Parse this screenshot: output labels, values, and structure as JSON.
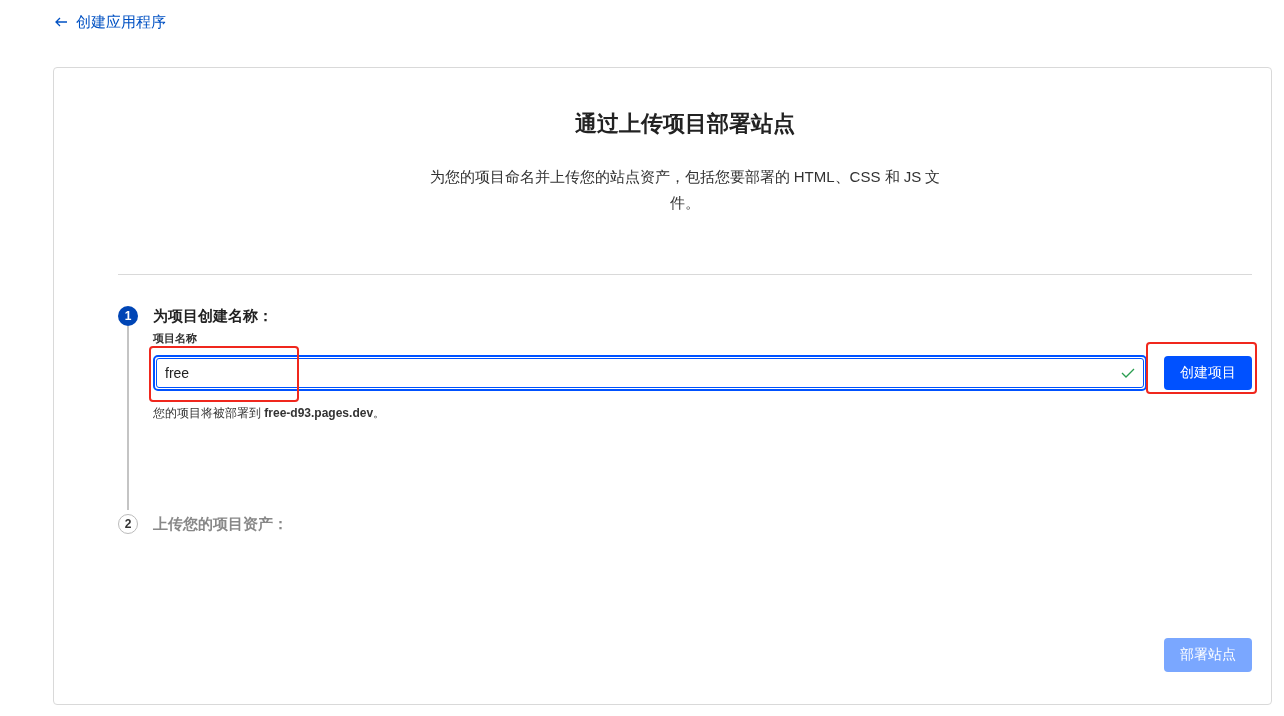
{
  "back_link": {
    "label": "创建应用程序"
  },
  "title": "通过上传项目部署站点",
  "description": "为您的项目命名并上传您的站点资产，包括您要部署的 HTML、CSS 和 JS 文件。",
  "steps": [
    {
      "number": "1",
      "title": "为项目创建名称：",
      "active": true,
      "field": {
        "label": "项目名称",
        "value": "free",
        "valid": true,
        "highlighted": true
      },
      "hint": "您的项目将被部署到 **free-d93.pages.dev**。",
      "button": {
        "label": "创建项目",
        "highlighted": true
      }
    },
    {
      "number": "2",
      "title": "上传您的项目资产：",
      "active": false
    }
  ],
  "deploy_button": {
    "label": "部署站点",
    "disabled": true
  }
}
